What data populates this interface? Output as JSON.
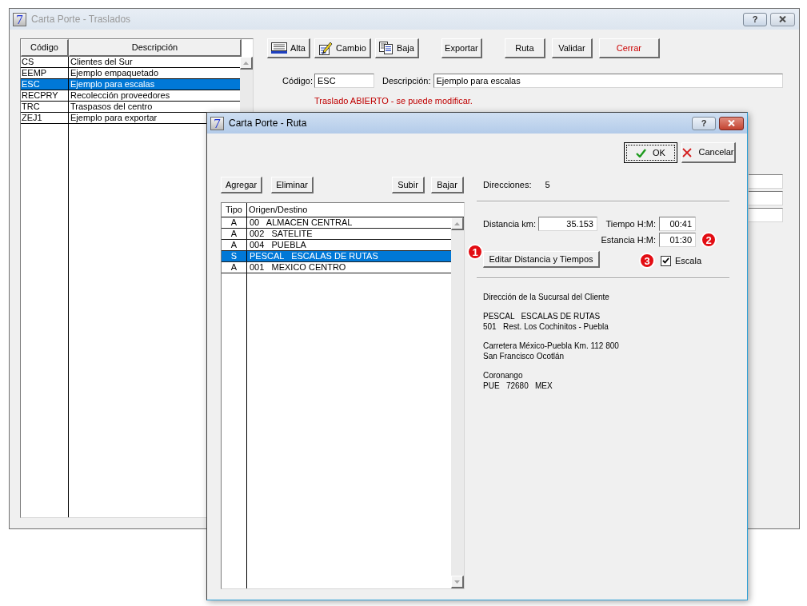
{
  "main_window": {
    "logo": "7",
    "title": "Carta Porte - Traslados",
    "help_button": "?",
    "list": {
      "columns": [
        "Código",
        "Descripción"
      ],
      "rows": [
        {
          "codigo": "CS",
          "descripcion": "Clientes del Sur",
          "selected": false
        },
        {
          "codigo": "EEMP",
          "descripcion": "Ejemplo empaquetado",
          "selected": false
        },
        {
          "codigo": "ESC",
          "descripcion": "Ejemplo para escalas",
          "selected": true
        },
        {
          "codigo": "RECPRY",
          "descripcion": "Recolección proveedores",
          "selected": false
        },
        {
          "codigo": "TRC",
          "descripcion": "Traspasos del centro",
          "selected": false
        },
        {
          "codigo": "ZEJ1",
          "descripcion": "Ejemplo para exportar",
          "selected": false
        }
      ]
    },
    "toolbar": [
      {
        "buttons": [
          {
            "label": "Alta",
            "kind": "add"
          },
          {
            "label": "Cambio",
            "kind": "edit"
          },
          {
            "label": "Baja",
            "kind": "delete"
          }
        ]
      },
      {
        "buttons": [
          {
            "label": "Exportar",
            "kind": "plain"
          }
        ]
      },
      {
        "buttons": [
          {
            "label": "Ruta",
            "kind": "plain"
          },
          {
            "label": "Validar",
            "kind": "plain"
          },
          {
            "label": "Cerrar",
            "kind": "close"
          }
        ]
      }
    ],
    "codigo": {
      "label": "Código:",
      "value": "ESC"
    },
    "descripcion": {
      "label": "Descripción:",
      "value": "Ejemplo para escalas"
    },
    "status_message": "Traslado ABIERTO - se puede modificar."
  },
  "dialog": {
    "logo": "7",
    "title": "Carta Porte - Ruta",
    "help_button": "?",
    "buttons": [
      {
        "label": "OK",
        "kind": "ok",
        "default": true
      },
      {
        "label": "Cancelar",
        "kind": "cancel",
        "default": false
      }
    ],
    "list_buttons_left": [
      "Agregar",
      "Eliminar"
    ],
    "list_buttons_right": [
      "Subir",
      "Bajar"
    ],
    "route_list": {
      "columns": [
        "Tipo",
        "Origen/Destino"
      ],
      "rows": [
        {
          "tipo": "A",
          "origen_destino": "00   ALMACEN CENTRAL",
          "selected": false
        },
        {
          "tipo": "A",
          "origen_destino": "002   SATELITE",
          "selected": false
        },
        {
          "tipo": "A",
          "origen_destino": "004   PUEBLA",
          "selected": false
        },
        {
          "tipo": "S",
          "origen_destino": "PESCAL   ESCALAS DE RUTAS",
          "selected": true
        },
        {
          "tipo": "A",
          "origen_destino": "001   MEXICO CENTRO",
          "selected": false
        }
      ]
    },
    "direcciones": {
      "label": "Direcciones:",
      "value": "5"
    },
    "distancia": {
      "label": "Distancia km:",
      "value": "35.153"
    },
    "tiempo": {
      "label": "Tiempo H:M:",
      "value": "00:41"
    },
    "estancia": {
      "label": "Estancia H:M:",
      "value": "01:30",
      "callout": "2"
    },
    "edit_button": {
      "label": "Editar Distancia y Tiempos",
      "callout": "1"
    },
    "escala": {
      "label": "Escala",
      "checked": true,
      "callout": "3"
    },
    "address": {
      "heading": "Dirección de la Sucursal del Cliente",
      "blocks": [
        [
          "PESCAL   ESCALAS DE RUTAS",
          "501   Rest. Los Cochinitos - Puebla"
        ],
        [
          "Carretera México-Puebla Km. 112 800",
          "San Francisco Ocotlán"
        ],
        [
          "Coronango",
          "PUE   72680   MEX"
        ]
      ]
    }
  }
}
